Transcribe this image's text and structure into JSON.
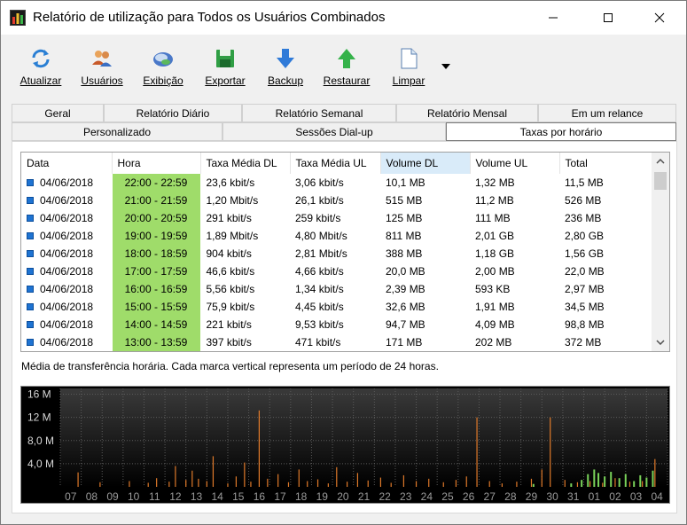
{
  "window": {
    "title": "Relatório de utilização para Todos os Usuários Combinados"
  },
  "toolbar": {
    "buttons": [
      {
        "label": "Atualizar",
        "icon": "refresh-icon"
      },
      {
        "label": "Usuários",
        "icon": "users-icon"
      },
      {
        "label": "Exibição",
        "icon": "view-icon"
      },
      {
        "label": "Exportar",
        "icon": "save-icon"
      },
      {
        "label": "Backup",
        "icon": "down-arrow-icon"
      },
      {
        "label": "Restaurar",
        "icon": "up-arrow-icon"
      },
      {
        "label": "Limpar",
        "icon": "document-icon"
      }
    ]
  },
  "tabs": {
    "row1": [
      "Geral",
      "Relatório Diário",
      "Relatório Semanal",
      "Relatório Mensal",
      "Em um relance"
    ],
    "row2": [
      "Personalizado",
      "Sessões Dial-up",
      "Taxas por horário"
    ],
    "active": "Taxas por horário"
  },
  "table": {
    "columns": [
      "Data",
      "Hora",
      "Taxa Média DL",
      "Taxa Média UL",
      "Volume DL",
      "Volume UL",
      "Total"
    ],
    "sorted_column": "Volume DL",
    "rows": [
      [
        "04/06/2018",
        "22:00 - 22:59",
        "23,6 kbit/s",
        "3,06 kbit/s",
        "10,1 MB",
        "1,32 MB",
        "11,5 MB"
      ],
      [
        "04/06/2018",
        "21:00 - 21:59",
        "1,20 Mbit/s",
        "26,1 kbit/s",
        "515 MB",
        "11,2 MB",
        "526 MB"
      ],
      [
        "04/06/2018",
        "20:00 - 20:59",
        "291 kbit/s",
        "259 kbit/s",
        "125 MB",
        "111 MB",
        "236 MB"
      ],
      [
        "04/06/2018",
        "19:00 - 19:59",
        "1,89 Mbit/s",
        "4,80 Mbit/s",
        "811 MB",
        "2,01 GB",
        "2,80 GB"
      ],
      [
        "04/06/2018",
        "18:00 - 18:59",
        "904 kbit/s",
        "2,81 Mbit/s",
        "388 MB",
        "1,18 GB",
        "1,56 GB"
      ],
      [
        "04/06/2018",
        "17:00 - 17:59",
        "46,6 kbit/s",
        "4,66 kbit/s",
        "20,0 MB",
        "2,00 MB",
        "22,0 MB"
      ],
      [
        "04/06/2018",
        "16:00 - 16:59",
        "5,56 kbit/s",
        "1,34 kbit/s",
        "2,39 MB",
        "593 KB",
        "2,97 MB"
      ],
      [
        "04/06/2018",
        "15:00 - 15:59",
        "75,9 kbit/s",
        "4,45 kbit/s",
        "32,6 MB",
        "1,91 MB",
        "34,5 MB"
      ],
      [
        "04/06/2018",
        "14:00 - 14:59",
        "221 kbit/s",
        "9,53 kbit/s",
        "94,7 MB",
        "4,09 MB",
        "98,8 MB"
      ],
      [
        "04/06/2018",
        "13:00 - 13:59",
        "397 kbit/s",
        "471 kbit/s",
        "171 MB",
        "202 MB",
        "372 MB"
      ]
    ]
  },
  "caption": "Média de transferência horária. Cada marca vertical representa um período de 24 horas.",
  "colors": {
    "hora_bg": "#9fdc6a",
    "sorted_header": "#d9ebf9",
    "download_bar": "#e07a2a",
    "upload_bar": "#7ad35a",
    "grid": "#5a5a5a"
  },
  "chart_data": {
    "type": "bar",
    "y_tick_labels": [
      "16 M",
      "12 M",
      "8,0 M",
      "4,0 M"
    ],
    "y_ticks": [
      16,
      12,
      8,
      4
    ],
    "ylim": [
      0,
      17
    ],
    "x_tick_labels": [
      "07",
      "08",
      "09",
      "10",
      "11",
      "12",
      "13",
      "14",
      "15",
      "16",
      "17",
      "18",
      "19",
      "20",
      "21",
      "22",
      "23",
      "24",
      "25",
      "26",
      "27",
      "28",
      "29",
      "30",
      "31",
      "01",
      "02",
      "03",
      "04"
    ],
    "grid": true,
    "series": [
      {
        "color": "#e07a2a",
        "bars": [
          {
            "day": 0.85,
            "value": 2.5
          },
          {
            "day": 1.9,
            "value": 0.8
          },
          {
            "day": 3.3,
            "value": 1.0
          },
          {
            "day": 4.2,
            "value": 0.7
          },
          {
            "day": 4.6,
            "value": 1.5
          },
          {
            "day": 5.2,
            "value": 0.9
          },
          {
            "day": 5.5,
            "value": 3.6
          },
          {
            "day": 6.0,
            "value": 1.2
          },
          {
            "day": 6.3,
            "value": 2.8
          },
          {
            "day": 6.6,
            "value": 1.4
          },
          {
            "day": 7.0,
            "value": 1.0
          },
          {
            "day": 7.3,
            "value": 5.3
          },
          {
            "day": 8.0,
            "value": 0.6
          },
          {
            "day": 8.4,
            "value": 1.8
          },
          {
            "day": 8.8,
            "value": 4.2
          },
          {
            "day": 9.1,
            "value": 0.9
          },
          {
            "day": 9.5,
            "value": 13.2
          },
          {
            "day": 9.9,
            "value": 1.4
          },
          {
            "day": 10.4,
            "value": 2.2
          },
          {
            "day": 10.9,
            "value": 0.8
          },
          {
            "day": 11.4,
            "value": 3.0
          },
          {
            "day": 11.8,
            "value": 1.0
          },
          {
            "day": 12.3,
            "value": 1.3
          },
          {
            "day": 12.8,
            "value": 0.6
          },
          {
            "day": 13.2,
            "value": 3.4
          },
          {
            "day": 13.7,
            "value": 0.9
          },
          {
            "day": 14.2,
            "value": 2.4
          },
          {
            "day": 14.7,
            "value": 1.1
          },
          {
            "day": 15.3,
            "value": 1.6
          },
          {
            "day": 15.8,
            "value": 0.7
          },
          {
            "day": 16.4,
            "value": 2.0
          },
          {
            "day": 17.0,
            "value": 1.0
          },
          {
            "day": 17.6,
            "value": 1.4
          },
          {
            "day": 18.3,
            "value": 0.8
          },
          {
            "day": 18.9,
            "value": 1.2
          },
          {
            "day": 19.4,
            "value": 1.8
          },
          {
            "day": 19.9,
            "value": 12.0
          },
          {
            "day": 20.5,
            "value": 1.0
          },
          {
            "day": 21.1,
            "value": 0.6
          },
          {
            "day": 21.8,
            "value": 0.9
          },
          {
            "day": 22.5,
            "value": 1.4
          },
          {
            "day": 23.0,
            "value": 3.0
          },
          {
            "day": 23.4,
            "value": 12.0
          },
          {
            "day": 24.1,
            "value": 1.2
          },
          {
            "day": 24.7,
            "value": 0.8
          },
          {
            "day": 25.3,
            "value": 1.0
          },
          {
            "day": 25.9,
            "value": 0.7
          },
          {
            "day": 26.5,
            "value": 1.5
          },
          {
            "day": 27.2,
            "value": 0.9
          },
          {
            "day": 27.8,
            "value": 1.0
          },
          {
            "day": 28.4,
            "value": 4.8
          }
        ]
      },
      {
        "color": "#7ad35a",
        "bars": [
          {
            "day": 22.6,
            "value": 0.5
          },
          {
            "day": 24.4,
            "value": 0.6
          },
          {
            "day": 24.9,
            "value": 1.2
          },
          {
            "day": 25.2,
            "value": 2.2
          },
          {
            "day": 25.5,
            "value": 3.0
          },
          {
            "day": 25.7,
            "value": 2.4
          },
          {
            "day": 26.0,
            "value": 1.8
          },
          {
            "day": 26.3,
            "value": 2.6
          },
          {
            "day": 26.7,
            "value": 1.5
          },
          {
            "day": 27.0,
            "value": 2.2
          },
          {
            "day": 27.4,
            "value": 1.0
          },
          {
            "day": 27.7,
            "value": 2.0
          },
          {
            "day": 28.0,
            "value": 1.6
          },
          {
            "day": 28.3,
            "value": 2.8
          }
        ]
      }
    ]
  }
}
